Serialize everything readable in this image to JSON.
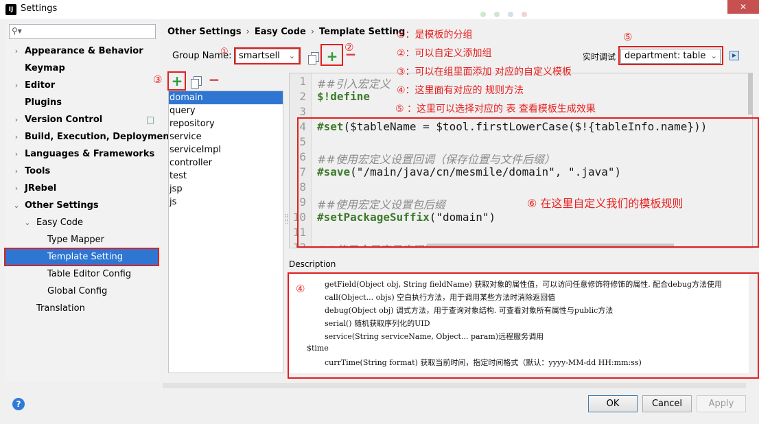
{
  "window": {
    "title": "Settings",
    "app_icon": "IJ",
    "close": "✕"
  },
  "sidebar": {
    "search": {
      "placeholder": ""
    },
    "items": [
      {
        "label": "Appearance & Behavior"
      },
      {
        "label": "Keymap"
      },
      {
        "label": "Editor"
      },
      {
        "label": "Plugins"
      },
      {
        "label": "Version Control"
      },
      {
        "label": "Build, Execution, Deployment"
      },
      {
        "label": "Languages & Frameworks"
      },
      {
        "label": "Tools"
      },
      {
        "label": "JRebel"
      },
      {
        "label": "Other Settings"
      },
      {
        "label": "Easy Code"
      },
      {
        "label": "Type Mapper"
      },
      {
        "label": "Template Setting"
      },
      {
        "label": "Table Editor Config"
      },
      {
        "label": "Global Config"
      },
      {
        "label": "Translation"
      }
    ]
  },
  "breadcrumb": [
    "Other Settings",
    "Easy Code",
    "Template Setting"
  ],
  "group": {
    "label": "Group Name:",
    "value": "smartsell"
  },
  "realtime": {
    "label": "实时调试",
    "value": "department: table"
  },
  "templates": [
    "domain",
    "query",
    "repository",
    "service",
    "serviceImpl",
    "controller",
    "test",
    "jsp",
    "js"
  ],
  "editor": {
    "line_numbers": [
      "1",
      "2",
      "3",
      "4",
      "5",
      "6",
      "7",
      "8",
      "9",
      "10",
      "11",
      "12"
    ],
    "lines": {
      "l1": "##引入宏定义",
      "l2_dir": "$!define",
      "l4_dir": "#set",
      "l4_rest": "($tableName = $tool.firstLowerCase($!{tableInfo.name}))",
      "l6": "##使用宏定义设置回调（保存位置与文件后缀）",
      "l7_dir": "#save",
      "l7_rest": "(\"/main/java/cn/mesmile/domain\", \".java\")",
      "l9": "##使用宏定义设置包后缀",
      "l10_dir": "#setPackageSuffix",
      "l10_rest": "(\"domain\")",
      "l12": "##使用全局变量实现默认包导入"
    }
  },
  "description": {
    "label": "Description",
    "lines": [
      "getField(Object obj, String fieldName) 获取对象的属性值，可以访问任意修饰符修饰的属性. 配合debug方法使用",
      "call(Object... objs) 空白执行方法，用于调用某些方法时消除返回值",
      "debug(Object obj) 调式方法，用于查询对象结构. 可查看对象所有属性与public方法",
      "serial() 随机获取序列化的UID",
      "service(String serviceName, Object... param)远程服务调用",
      "$time",
      "currTime(String format) 获取当前时间，指定时间格式（默认：yyyy-MM-dd HH:mm:ss)"
    ]
  },
  "buttons": {
    "ok": "OK",
    "cancel": "Cancel",
    "apply": "Apply",
    "help": "?"
  },
  "annotations": {
    "n1": "①",
    "n2": "②",
    "n3": "③",
    "n4": "④",
    "n5": "⑤",
    "notes": [
      "①：是模板的分组",
      "②：可以自定义添加组",
      "③：可以在组里面添加 对应的自定义模板",
      "④：这里面有对应的 规则方法",
      "⑤ ：这里可以选择对应的 表 查看模板生成效果"
    ],
    "note6": "⑥ 在这里自定义我们的模板规则"
  },
  "colors": {
    "accent": "#2e76d2",
    "annotation": "#e01f1f",
    "add_green": "#2c9c38",
    "remove_red": "#d83c3c"
  }
}
